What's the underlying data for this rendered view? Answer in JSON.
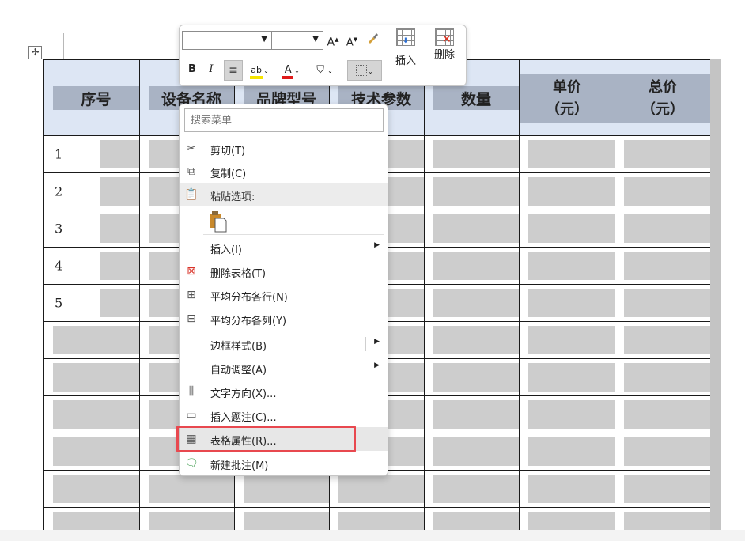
{
  "table": {
    "headers": [
      "序号",
      "设备名称",
      "品牌型号",
      "技术参数",
      "数量",
      [
        "单价",
        "（元）"
      ],
      [
        "总价",
        "（元）"
      ]
    ],
    "row_numbers": [
      "1",
      "2",
      "3",
      "4",
      "5",
      "",
      "",
      "",
      "",
      "",
      ""
    ]
  },
  "toolbar": {
    "bold": "B",
    "italic": "I",
    "grow_font": "A",
    "shrink_font": "A",
    "insert_label": "插入",
    "delete_label": "删除"
  },
  "context_menu": {
    "search_placeholder": "搜索菜单",
    "items": {
      "cut": "剪切(T)",
      "copy": "复制(C)",
      "paste_options": "粘贴选项:",
      "insert": "插入(I)",
      "delete_table": "删除表格(T)",
      "distribute_rows": "平均分布各行(N)",
      "distribute_cols": "平均分布各列(Y)",
      "border_styles": "边框样式(B)",
      "autofit": "自动调整(A)",
      "text_direction": "文字方向(X)...",
      "insert_caption": "插入题注(C)...",
      "table_properties": "表格属性(R)...",
      "new_comment": "新建批注(M)"
    }
  },
  "colors": {
    "header_fill": "#dde6f4",
    "header_band": "#a9b3c4",
    "cell_fill": "#cdcdcd",
    "highlight": "#e8484f"
  }
}
